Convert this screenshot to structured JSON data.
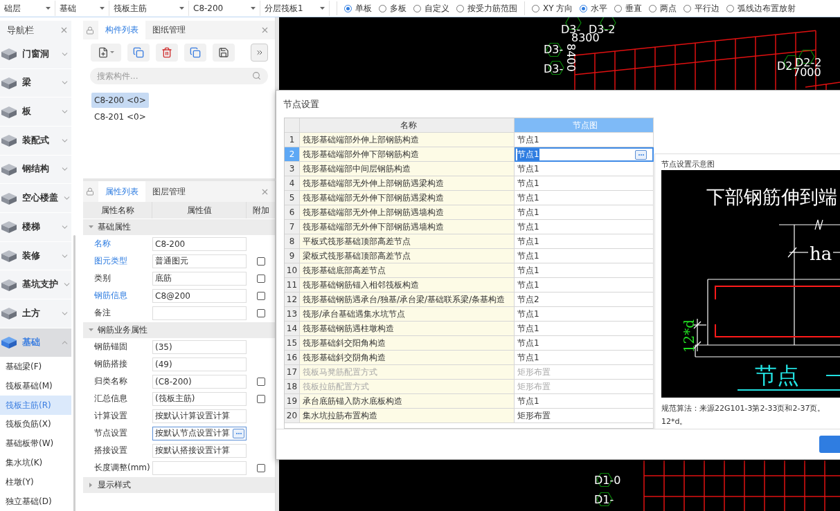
{
  "toolbar": {
    "dropdowns": [
      "础层",
      "基础",
      "筏板主筋",
      "C8-200",
      "分层筏板1"
    ],
    "placement_modes": [
      {
        "label": "单板",
        "selected": true
      },
      {
        "label": "多板",
        "selected": false
      },
      {
        "label": "自定义",
        "selected": false
      },
      {
        "label": "按受力筋范围",
        "selected": false
      }
    ],
    "directions": [
      {
        "label": "XY 方向",
        "selected": false
      },
      {
        "label": "水平",
        "selected": true
      },
      {
        "label": "垂直",
        "selected": false
      },
      {
        "label": "两点",
        "selected": false
      },
      {
        "label": "平行边",
        "selected": false
      },
      {
        "label": "弧线边布置放射",
        "selected": false
      }
    ]
  },
  "nav": {
    "title": "导航栏",
    "categories": [
      {
        "label": "门窗洞",
        "selected": false,
        "expanded": false
      },
      {
        "label": "梁",
        "selected": false,
        "expanded": false
      },
      {
        "label": "板",
        "selected": false,
        "expanded": false
      },
      {
        "label": "装配式",
        "selected": false,
        "expanded": false
      },
      {
        "label": "钢结构",
        "selected": false,
        "expanded": false
      },
      {
        "label": "空心楼盖",
        "selected": false,
        "expanded": false
      },
      {
        "label": "楼梯",
        "selected": false,
        "expanded": false
      },
      {
        "label": "装修",
        "selected": false,
        "expanded": false
      },
      {
        "label": "基坑支护",
        "selected": false,
        "expanded": false
      },
      {
        "label": "土方",
        "selected": false,
        "expanded": false
      },
      {
        "label": "基础",
        "selected": true,
        "expanded": true
      }
    ],
    "sub_items": [
      {
        "label": "基础梁(F)",
        "selected": false
      },
      {
        "label": "筏板基础(M)",
        "selected": false
      },
      {
        "label": "筏板主筋(R)",
        "selected": true
      },
      {
        "label": "筏板负筋(X)",
        "selected": false
      },
      {
        "label": "基础板带(W)",
        "selected": false
      },
      {
        "label": "集水坑(K)",
        "selected": false
      },
      {
        "label": "柱墩(Y)",
        "selected": false
      },
      {
        "label": "独立基础(D)",
        "selected": false
      }
    ]
  },
  "component_tabs": [
    {
      "label": "构件列表",
      "selected": true
    },
    {
      "label": "图纸管理",
      "selected": false
    }
  ],
  "search": {
    "placeholder": "搜索构件..."
  },
  "components": [
    {
      "label": "C8-200 <0>",
      "selected": true
    },
    {
      "label": "C8-201 <0>",
      "selected": false
    }
  ],
  "property_tabs": [
    {
      "label": "属性列表",
      "selected": true
    },
    {
      "label": "图层管理",
      "selected": false
    }
  ],
  "property_columns": [
    "属性名称",
    "属性值",
    "附加"
  ],
  "property_groups": [
    {
      "title": "基础属性",
      "expanded": true,
      "rows": [
        {
          "kind": "text",
          "name": "名称",
          "value": "C8-200",
          "linked": true
        },
        {
          "kind": "text",
          "name": "图元类型",
          "value": "普通图元",
          "linked": true,
          "checked": false
        },
        {
          "kind": "text",
          "name": "类别",
          "value": "底筋",
          "linked": false,
          "checked": false
        },
        {
          "kind": "text",
          "name": "钢筋信息",
          "value": "C8@200",
          "linked": true,
          "checked": false
        },
        {
          "kind": "text",
          "name": "备注",
          "value": "",
          "linked": false,
          "checked": false
        }
      ]
    },
    {
      "title": "钢筋业务属性",
      "expanded": true,
      "rows": [
        {
          "kind": "text",
          "name": "钢筋锚固",
          "value": "(35)",
          "linked": false
        },
        {
          "kind": "text",
          "name": "钢筋搭接",
          "value": "(49)",
          "linked": false
        },
        {
          "kind": "text",
          "name": "归类名称",
          "value": "(C8-200)",
          "linked": false,
          "checked": false
        },
        {
          "kind": "text",
          "name": "汇总信息",
          "value": "(筏板主筋)",
          "linked": false,
          "checked": false
        },
        {
          "kind": "text",
          "name": "计算设置",
          "value": "按默认计算设置计算",
          "linked": false
        },
        {
          "kind": "ellipsis",
          "name": "节点设置",
          "value": "按默认节点设置计算",
          "linked": false
        },
        {
          "kind": "text",
          "name": "搭接设置",
          "value": "按默认搭接设置计算",
          "linked": false
        },
        {
          "kind": "text",
          "name": "长度调整(mm)",
          "value": "",
          "linked": false,
          "checked": false
        }
      ]
    },
    {
      "title": "显示样式",
      "expanded": false
    }
  ],
  "cad_labels": [
    "D3-",
    "D3-2",
    "8300",
    "D3-",
    "D3-",
    "8400",
    "D2",
    "D2-2",
    "7000",
    "D1-0",
    "D1-"
  ],
  "dialog": {
    "title": "节点设置",
    "columns": [
      "名称",
      "节点图"
    ],
    "rows": [
      {
        "number": "1",
        "name": "筏形基础端部外伸上部钢筋构造",
        "value": "节点1",
        "selected": false,
        "disabled": false
      },
      {
        "number": "2",
        "name": "筏形基础端部外伸下部钢筋构造",
        "value": "节点1",
        "selected": true,
        "disabled": false
      },
      {
        "number": "3",
        "name": "筏形基础端部中间层钢筋构造",
        "value": "节点1",
        "selected": false,
        "disabled": false
      },
      {
        "number": "4",
        "name": "筏形基础端部无外伸上部钢筋遇梁构造",
        "value": "节点1",
        "selected": false,
        "disabled": false
      },
      {
        "number": "5",
        "name": "筏形基础端部无外伸下部钢筋遇梁构造",
        "value": "节点1",
        "selected": false,
        "disabled": false
      },
      {
        "number": "6",
        "name": "筏形基础端部无外伸上部钢筋遇墙构造",
        "value": "节点1",
        "selected": false,
        "disabled": false
      },
      {
        "number": "7",
        "name": "筏形基础端部无外伸下部钢筋遇墙构造",
        "value": "节点1",
        "selected": false,
        "disabled": false
      },
      {
        "number": "8",
        "name": "平板式筏形基础顶部高差节点",
        "value": "节点1",
        "selected": false,
        "disabled": false
      },
      {
        "number": "9",
        "name": "梁板式筏形基础顶部高差节点",
        "value": "节点1",
        "selected": false,
        "disabled": false
      },
      {
        "number": "10",
        "name": "筏形基础底部高差节点",
        "value": "节点1",
        "selected": false,
        "disabled": false
      },
      {
        "number": "11",
        "name": "筏形基础钢筋锚入相邻筏板构造",
        "value": "节点1",
        "selected": false,
        "disabled": false
      },
      {
        "number": "12",
        "name": "筏形基础钢筋遇承台/独基/承台梁/基础联系梁/条基构造",
        "value": "节点2",
        "selected": false,
        "disabled": false
      },
      {
        "number": "13",
        "name": "筏形/承台基础遇集水坑节点",
        "value": "节点1",
        "selected": false,
        "disabled": false
      },
      {
        "number": "14",
        "name": "筏形基础钢筋遇柱墩构造",
        "value": "节点1",
        "selected": false,
        "disabled": false
      },
      {
        "number": "15",
        "name": "筏形基础斜交阳角构造",
        "value": "节点1",
        "selected": false,
        "disabled": false
      },
      {
        "number": "16",
        "name": "筏形基础斜交阴角构造",
        "value": "节点1",
        "selected": false,
        "disabled": false
      },
      {
        "number": "17",
        "name": "筏板马凳筋配置方式",
        "value": "矩形布置",
        "selected": false,
        "disabled": true
      },
      {
        "number": "18",
        "name": "筏板拉筋配置方式",
        "value": "矩形布置",
        "selected": false,
        "disabled": true
      },
      {
        "number": "19",
        "name": "承台底筋锚入防水底板构造",
        "value": "节点1",
        "selected": false,
        "disabled": false
      },
      {
        "number": "20",
        "name": "集水坑拉筋布置构造",
        "value": "矩形布置",
        "selected": false,
        "disabled": false
      }
    ],
    "preview": {
      "title": "节点设置示意图",
      "heading": "下部钢筋伸到端",
      "dimension": "ha",
      "side_dimension": "12*d",
      "node_label": "节点",
      "description": [
        "规范算法：来源22G101-3第2-33页和2-37页。",
        "12*d。"
      ]
    }
  }
}
